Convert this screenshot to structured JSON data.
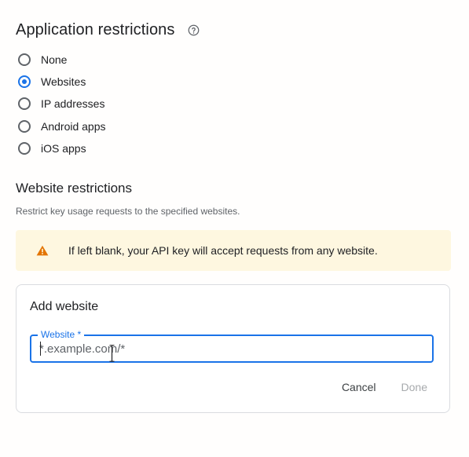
{
  "application_restrictions": {
    "title": "Application restrictions",
    "help_icon": "help-circle-icon",
    "options": [
      {
        "label": "None",
        "selected": false
      },
      {
        "label": "Websites",
        "selected": true
      },
      {
        "label": "IP addresses",
        "selected": false
      },
      {
        "label": "Android apps",
        "selected": false
      },
      {
        "label": "iOS apps",
        "selected": false
      }
    ]
  },
  "website_restrictions": {
    "title": "Website restrictions",
    "description": "Restrict key usage requests to the specified websites.",
    "warning": {
      "icon": "warning-icon",
      "text": "If left blank, your API key will accept requests from any website."
    }
  },
  "add_website": {
    "title": "Add website",
    "field_label": "Website *",
    "placeholder": "*.example.com/*",
    "value": "",
    "cancel_label": "Cancel",
    "done_label": "Done"
  },
  "colors": {
    "accent": "#1a73e8",
    "warning_bg": "#fef7e0",
    "warning_icon": "#e37400",
    "disabled_text": "#a7aaad"
  }
}
